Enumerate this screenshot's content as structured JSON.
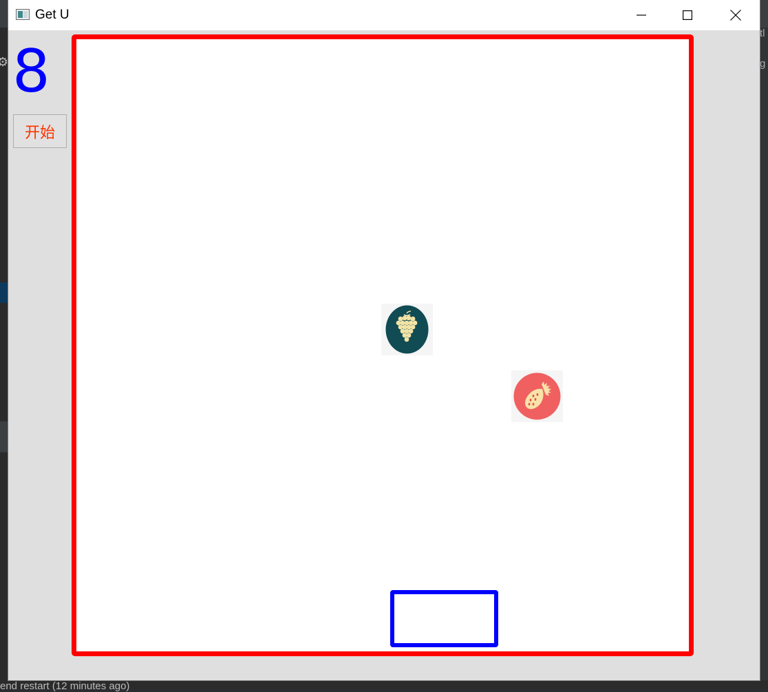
{
  "window": {
    "title": "Get U",
    "controls": {
      "minimize_icon": "minimize-icon",
      "maximize_icon": "maximize-icon",
      "close_icon": "close-icon"
    }
  },
  "hud": {
    "score": "8",
    "start_label": "开始",
    "score_color": "#0000ff",
    "start_label_color": "#ff3300"
  },
  "arena": {
    "border_color": "#ff0000",
    "paddle_color": "#0000ff",
    "fruits": [
      {
        "kind": "grape",
        "icon": "grape-icon",
        "bg": "#114b54",
        "fg": "#f3e3a5"
      },
      {
        "kind": "strawberry",
        "icon": "strawberry-icon",
        "bg": "#f06060",
        "fg": "#f8e3a8"
      }
    ]
  },
  "background": {
    "bottom_text": "end restart (12 minutes ago)",
    "right_text_1": "tl",
    "right_text_2": "g"
  }
}
